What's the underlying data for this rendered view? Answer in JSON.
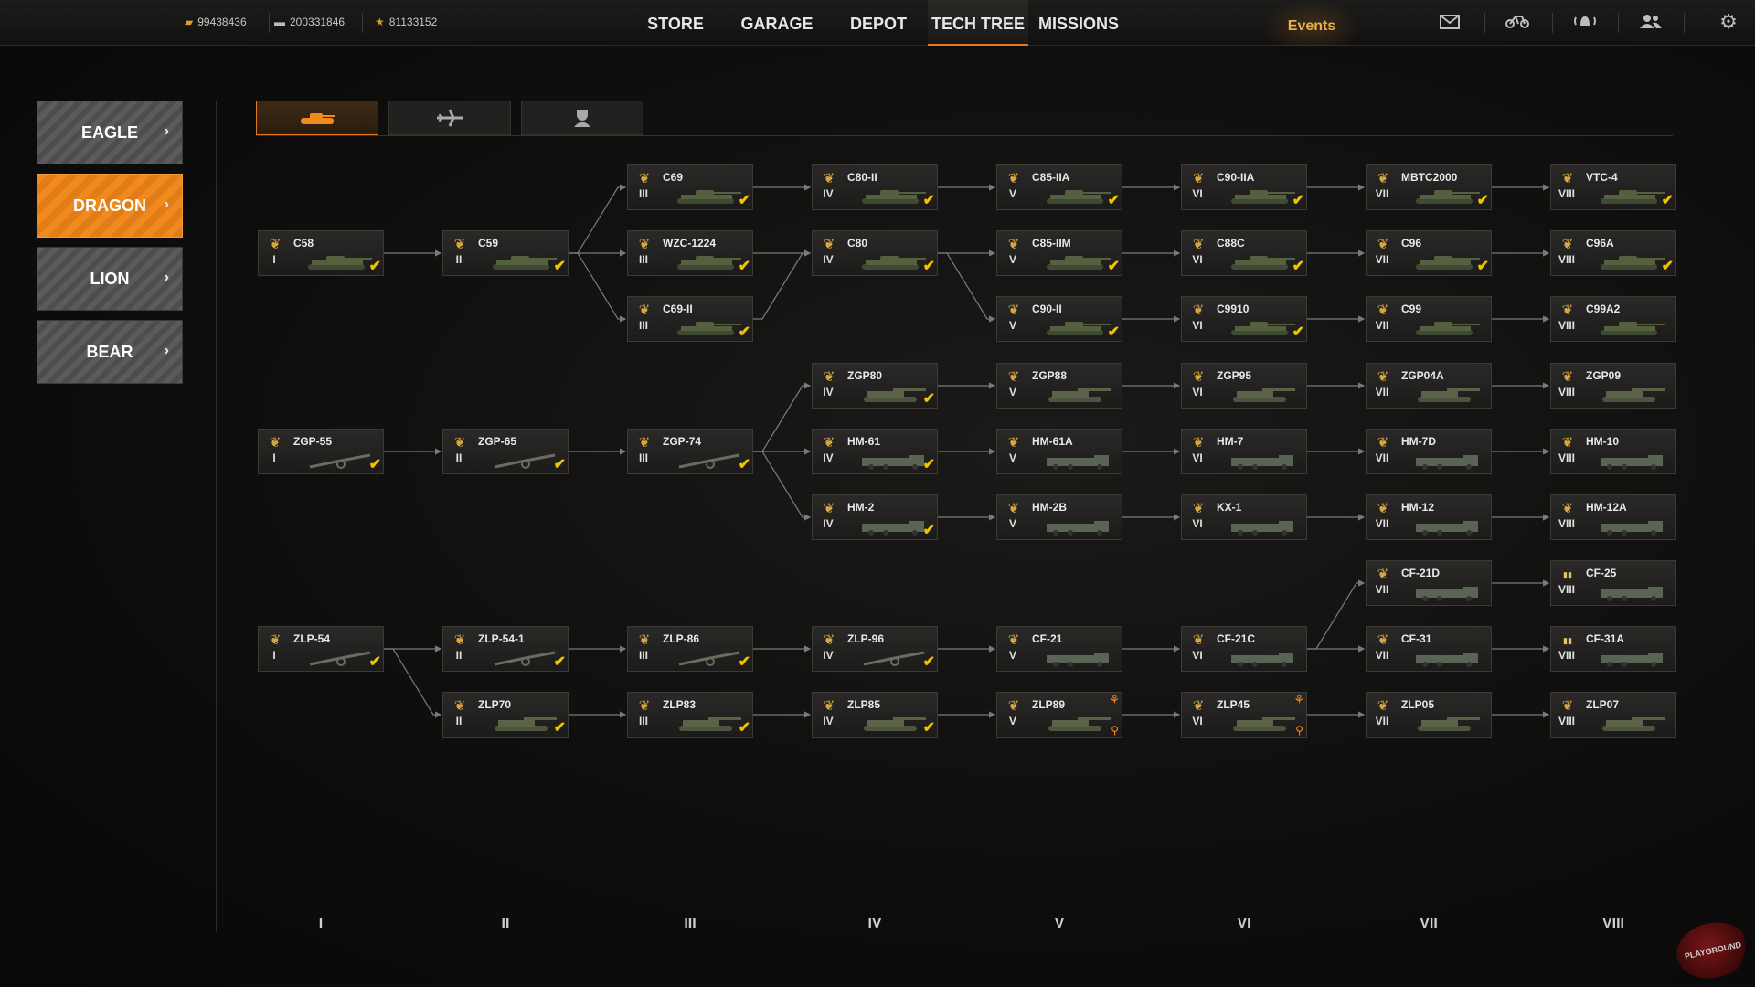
{
  "currencies": [
    {
      "icon": "gold-bars-icon",
      "value": "99438436"
    },
    {
      "icon": "silver-tank-icon",
      "value": "200331846"
    },
    {
      "icon": "star-xp-icon",
      "value": "81133152"
    }
  ],
  "nav": [
    {
      "label": "STORE",
      "active": false
    },
    {
      "label": "GARAGE",
      "active": false
    },
    {
      "label": "DEPOT",
      "active": false
    },
    {
      "label": "TECH TREE",
      "active": true
    },
    {
      "label": "MISSIONS",
      "active": false
    }
  ],
  "events_label": "Events",
  "top_icons": [
    "mail-icon",
    "bike-icon",
    "notification-icon",
    "friends-icon",
    "settings-icon"
  ],
  "nations": [
    {
      "label": "EAGLE",
      "active": false
    },
    {
      "label": "DRAGON",
      "active": true
    },
    {
      "label": "LION",
      "active": false
    },
    {
      "label": "BEAR",
      "active": false
    }
  ],
  "vehicle_types": [
    {
      "icon": "tank-icon",
      "active": true
    },
    {
      "icon": "plane-icon",
      "active": false
    },
    {
      "icon": "commander-icon",
      "active": false
    }
  ],
  "columns": [
    "I",
    "II",
    "III",
    "IV",
    "V",
    "VI",
    "VII",
    "VIII"
  ],
  "vehicles": [
    {
      "name": "C58",
      "tier": "I",
      "col": 0,
      "row": 1,
      "status": "owned"
    },
    {
      "name": "C59",
      "tier": "II",
      "col": 1,
      "row": 1,
      "status": "owned"
    },
    {
      "name": "C69",
      "tier": "III",
      "col": 2,
      "row": 0,
      "status": "owned"
    },
    {
      "name": "WZC-1224",
      "tier": "III",
      "col": 2,
      "row": 1,
      "status": "owned"
    },
    {
      "name": "C69-II",
      "tier": "III",
      "col": 2,
      "row": 2,
      "status": "owned"
    },
    {
      "name": "C80-II",
      "tier": "IV",
      "col": 3,
      "row": 0,
      "status": "owned"
    },
    {
      "name": "C80",
      "tier": "IV",
      "col": 3,
      "row": 1,
      "status": "owned"
    },
    {
      "name": "C85-IIA",
      "tier": "V",
      "col": 4,
      "row": 0,
      "status": "owned"
    },
    {
      "name": "C85-IIM",
      "tier": "V",
      "col": 4,
      "row": 1,
      "status": "owned"
    },
    {
      "name": "C90-II",
      "tier": "V",
      "col": 4,
      "row": 2,
      "status": "owned"
    },
    {
      "name": "C90-IIA",
      "tier": "VI",
      "col": 5,
      "row": 0,
      "status": "owned"
    },
    {
      "name": "C88C",
      "tier": "VI",
      "col": 5,
      "row": 1,
      "status": "owned"
    },
    {
      "name": "C9910",
      "tier": "VI",
      "col": 5,
      "row": 2,
      "status": "owned"
    },
    {
      "name": "MBTC2000",
      "tier": "VII",
      "col": 6,
      "row": 0,
      "status": "owned"
    },
    {
      "name": "C96",
      "tier": "VII",
      "col": 6,
      "row": 1,
      "status": "owned"
    },
    {
      "name": "C99",
      "tier": "VII",
      "col": 6,
      "row": 2,
      "status": "none"
    },
    {
      "name": "VTC-4",
      "tier": "VIII",
      "col": 7,
      "row": 0,
      "status": "owned"
    },
    {
      "name": "C96A",
      "tier": "VIII",
      "col": 7,
      "row": 1,
      "status": "owned"
    },
    {
      "name": "C99A2",
      "tier": "VIII",
      "col": 7,
      "row": 2,
      "status": "none"
    },
    {
      "name": "ZGP80",
      "tier": "IV",
      "col": 3,
      "row": 3,
      "status": "owned"
    },
    {
      "name": "ZGP88",
      "tier": "V",
      "col": 4,
      "row": 3,
      "status": "none"
    },
    {
      "name": "ZGP95",
      "tier": "VI",
      "col": 5,
      "row": 3,
      "status": "none"
    },
    {
      "name": "ZGP04A",
      "tier": "VII",
      "col": 6,
      "row": 3,
      "status": "none"
    },
    {
      "name": "ZGP09",
      "tier": "VIII",
      "col": 7,
      "row": 3,
      "status": "none"
    },
    {
      "name": "ZGP-55",
      "tier": "I",
      "col": 0,
      "row": 4,
      "status": "owned"
    },
    {
      "name": "ZGP-65",
      "tier": "II",
      "col": 1,
      "row": 4,
      "status": "owned"
    },
    {
      "name": "ZGP-74",
      "tier": "III",
      "col": 2,
      "row": 4,
      "status": "owned"
    },
    {
      "name": "HM-61",
      "tier": "IV",
      "col": 3,
      "row": 4,
      "status": "owned"
    },
    {
      "name": "HM-61A",
      "tier": "V",
      "col": 4,
      "row": 4,
      "status": "none"
    },
    {
      "name": "HM-7",
      "tier": "VI",
      "col": 5,
      "row": 4,
      "status": "none"
    },
    {
      "name": "HM-7D",
      "tier": "VII",
      "col": 6,
      "row": 4,
      "status": "none"
    },
    {
      "name": "HM-10",
      "tier": "VIII",
      "col": 7,
      "row": 4,
      "status": "none"
    },
    {
      "name": "HM-2",
      "tier": "IV",
      "col": 3,
      "row": 5,
      "status": "owned"
    },
    {
      "name": "HM-2B",
      "tier": "V",
      "col": 4,
      "row": 5,
      "status": "none"
    },
    {
      "name": "KX-1",
      "tier": "VI",
      "col": 5,
      "row": 5,
      "status": "none"
    },
    {
      "name": "HM-12",
      "tier": "VII",
      "col": 6,
      "row": 5,
      "status": "none"
    },
    {
      "name": "HM-12A",
      "tier": "VIII",
      "col": 7,
      "row": 5,
      "status": "none"
    },
    {
      "name": "CF-21D",
      "tier": "VII",
      "col": 6,
      "row": 6,
      "status": "none"
    },
    {
      "name": "CF-25",
      "tier": "VIII",
      "col": 7,
      "row": 6,
      "status": "none",
      "premium": true
    },
    {
      "name": "ZLP-54",
      "tier": "I",
      "col": 0,
      "row": 7,
      "status": "owned"
    },
    {
      "name": "ZLP-54-1",
      "tier": "II",
      "col": 1,
      "row": 7,
      "status": "owned"
    },
    {
      "name": "ZLP-86",
      "tier": "III",
      "col": 2,
      "row": 7,
      "status": "owned"
    },
    {
      "name": "ZLP-96",
      "tier": "IV",
      "col": 3,
      "row": 7,
      "status": "owned"
    },
    {
      "name": "CF-21",
      "tier": "V",
      "col": 4,
      "row": 7,
      "status": "none"
    },
    {
      "name": "CF-21C",
      "tier": "VI",
      "col": 5,
      "row": 7,
      "status": "none"
    },
    {
      "name": "CF-31",
      "tier": "VII",
      "col": 6,
      "row": 7,
      "status": "none"
    },
    {
      "name": "CF-31A",
      "tier": "VIII",
      "col": 7,
      "row": 7,
      "status": "none",
      "premium": true
    },
    {
      "name": "ZLP70",
      "tier": "II",
      "col": 1,
      "row": 8,
      "status": "owned"
    },
    {
      "name": "ZLP83",
      "tier": "III",
      "col": 2,
      "row": 8,
      "status": "owned"
    },
    {
      "name": "ZLP85",
      "tier": "IV",
      "col": 3,
      "row": 8,
      "status": "owned"
    },
    {
      "name": "ZLP89",
      "tier": "V",
      "col": 4,
      "row": 8,
      "status": "researching"
    },
    {
      "name": "ZLP45",
      "tier": "VI",
      "col": 5,
      "row": 8,
      "status": "researching"
    },
    {
      "name": "ZLP05",
      "tier": "VII",
      "col": 6,
      "row": 8,
      "status": "none"
    },
    {
      "name": "ZLP07",
      "tier": "VIII",
      "col": 7,
      "row": 8,
      "status": "none"
    }
  ],
  "links": [
    [
      "C58",
      "C59"
    ],
    [
      "C59",
      "C69"
    ],
    [
      "C59",
      "WZC-1224"
    ],
    [
      "C59",
      "C69-II"
    ],
    [
      "C69",
      "C80-II"
    ],
    [
      "WZC-1224",
      "C80"
    ],
    [
      "C69-II",
      "C80"
    ],
    [
      "C80-II",
      "C85-IIA"
    ],
    [
      "C80",
      "C85-IIM"
    ],
    [
      "C80",
      "C90-II"
    ],
    [
      "C85-IIA",
      "C90-IIA"
    ],
    [
      "C85-IIM",
      "C88C"
    ],
    [
      "C90-II",
      "C9910"
    ],
    [
      "C90-IIA",
      "MBTC2000"
    ],
    [
      "C88C",
      "C96"
    ],
    [
      "C9910",
      "C99"
    ],
    [
      "MBTC2000",
      "VTC-4"
    ],
    [
      "C96",
      "C96A"
    ],
    [
      "C99",
      "C99A2"
    ],
    [
      "ZGP80",
      "ZGP88"
    ],
    [
      "ZGP88",
      "ZGP95"
    ],
    [
      "ZGP95",
      "ZGP04A"
    ],
    [
      "ZGP04A",
      "ZGP09"
    ],
    [
      "ZGP-55",
      "ZGP-65"
    ],
    [
      "ZGP-65",
      "ZGP-74"
    ],
    [
      "ZGP-74",
      "ZGP80"
    ],
    [
      "ZGP-74",
      "HM-61"
    ],
    [
      "ZGP-74",
      "HM-2"
    ],
    [
      "HM-61",
      "HM-61A"
    ],
    [
      "HM-61A",
      "HM-7"
    ],
    [
      "HM-7",
      "HM-7D"
    ],
    [
      "HM-7D",
      "HM-10"
    ],
    [
      "HM-2",
      "HM-2B"
    ],
    [
      "HM-2B",
      "KX-1"
    ],
    [
      "KX-1",
      "HM-12"
    ],
    [
      "HM-12",
      "HM-12A"
    ],
    [
      "CF-21D",
      "CF-25"
    ],
    [
      "ZLP-54",
      "ZLP-54-1"
    ],
    [
      "ZLP-54",
      "ZLP70"
    ],
    [
      "ZLP-54-1",
      "ZLP-86"
    ],
    [
      "ZLP-86",
      "ZLP-96"
    ],
    [
      "ZLP-96",
      "CF-21"
    ],
    [
      "CF-21",
      "CF-21C"
    ],
    [
      "CF-21C",
      "CF-31"
    ],
    [
      "CF-21C",
      "CF-21D"
    ],
    [
      "CF-31",
      "CF-31A"
    ],
    [
      "ZLP70",
      "ZLP83"
    ],
    [
      "ZLP83",
      "ZLP85"
    ],
    [
      "ZLP85",
      "ZLP89"
    ],
    [
      "ZLP89",
      "ZLP45"
    ],
    [
      "ZLP45",
      "ZLP05"
    ],
    [
      "ZLP05",
      "ZLP07"
    ]
  ],
  "colors": {
    "accent": "#e07a1c",
    "check": "#f0c400",
    "line": "#7a7a7a"
  },
  "watermark": "PLAYGROUND"
}
